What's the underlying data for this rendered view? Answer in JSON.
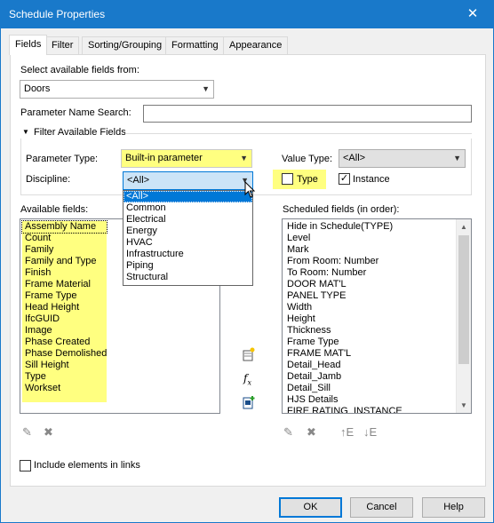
{
  "window": {
    "title": "Schedule Properties",
    "close_glyph": "✕"
  },
  "tabs": [
    {
      "label": "Fields"
    },
    {
      "label": "Filter"
    },
    {
      "label": "Sorting/Grouping"
    },
    {
      "label": "Formatting"
    },
    {
      "label": "Appearance"
    }
  ],
  "select_fields": {
    "label": "Select available fields from:",
    "value": "Doors"
  },
  "param_search": {
    "label": "Parameter Name Search:",
    "value": ""
  },
  "filter": {
    "header": "Filter Available Fields",
    "param_type_label": "Parameter Type:",
    "param_type_value": "Built-in parameter",
    "value_type_label": "Value Type:",
    "value_type_value": "<All>",
    "discipline_label": "Discipline:",
    "discipline_value": "<All>",
    "discipline_options": [
      "<All>",
      "Common",
      "Electrical",
      "Energy",
      "HVAC",
      "Infrastructure",
      "Piping",
      "Structural"
    ],
    "type_label": "Type",
    "instance_label": "Instance",
    "type_checked": false,
    "instance_checked": true
  },
  "available": {
    "label": "Available fields:",
    "items": [
      "Assembly Name",
      "Count",
      "Family",
      "Family and Type",
      "Finish",
      "Frame Material",
      "Frame Type",
      "Head Height",
      "IfcGUID",
      "Image",
      "Phase Created",
      "Phase Demolished",
      "Sill Height",
      "Type",
      "Workset"
    ]
  },
  "scheduled": {
    "label": "Scheduled fields (in order):",
    "items": [
      "Hide in Schedule(TYPE)",
      "Level",
      "Mark",
      "From Room: Number",
      "To Room: Number",
      "DOOR MAT'L",
      "PANEL TYPE",
      "Width",
      "Height",
      "Thickness",
      "Frame Type",
      "FRAME MAT'L",
      "Detail_Head",
      "Detail_Jamb",
      "Detail_Sill",
      "HJS Details",
      "FIRE RATING_INSTANCE"
    ]
  },
  "include_links": {
    "label": "Include elements in links",
    "checked": false
  },
  "buttons": {
    "ok": "OK",
    "cancel": "Cancel",
    "help": "Help"
  },
  "colors": {
    "titlebar": "#1979ca",
    "highlight": "#ffff80",
    "selection": "#0078d7"
  }
}
